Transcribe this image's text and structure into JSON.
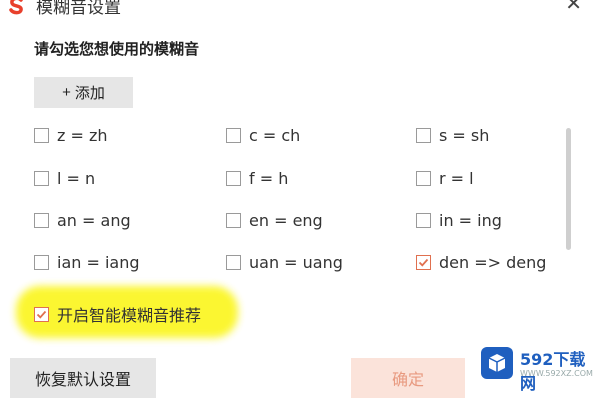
{
  "window": {
    "title": "模糊音设置",
    "close_glyph": "✕"
  },
  "prompt": "请勾选您想使用的模糊音",
  "add_button": {
    "icon": "+",
    "label": "添加"
  },
  "options": [
    {
      "label": "z = zh",
      "checked": false
    },
    {
      "label": "c = ch",
      "checked": false
    },
    {
      "label": "s = sh",
      "checked": false
    },
    {
      "label": "l = n",
      "checked": false
    },
    {
      "label": "f = h",
      "checked": false
    },
    {
      "label": "r = l",
      "checked": false
    },
    {
      "label": "an = ang",
      "checked": false
    },
    {
      "label": "en = eng",
      "checked": false
    },
    {
      "label": "in = ing",
      "checked": false
    },
    {
      "label": "ian = iang",
      "checked": false
    },
    {
      "label": "uan = uang",
      "checked": false
    },
    {
      "label": "den => deng",
      "checked": true
    }
  ],
  "smart_recommend": {
    "label": "开启智能模糊音推荐",
    "checked": true
  },
  "buttons": {
    "reset": "恢复默认设置",
    "ok": "确定"
  },
  "watermark": {
    "brand": "592下载网",
    "url": "WWW.592XZ.COM"
  },
  "colors": {
    "accent": "#e0704f",
    "highlight": "#fbf626",
    "ok_bg": "#fbe3da"
  }
}
